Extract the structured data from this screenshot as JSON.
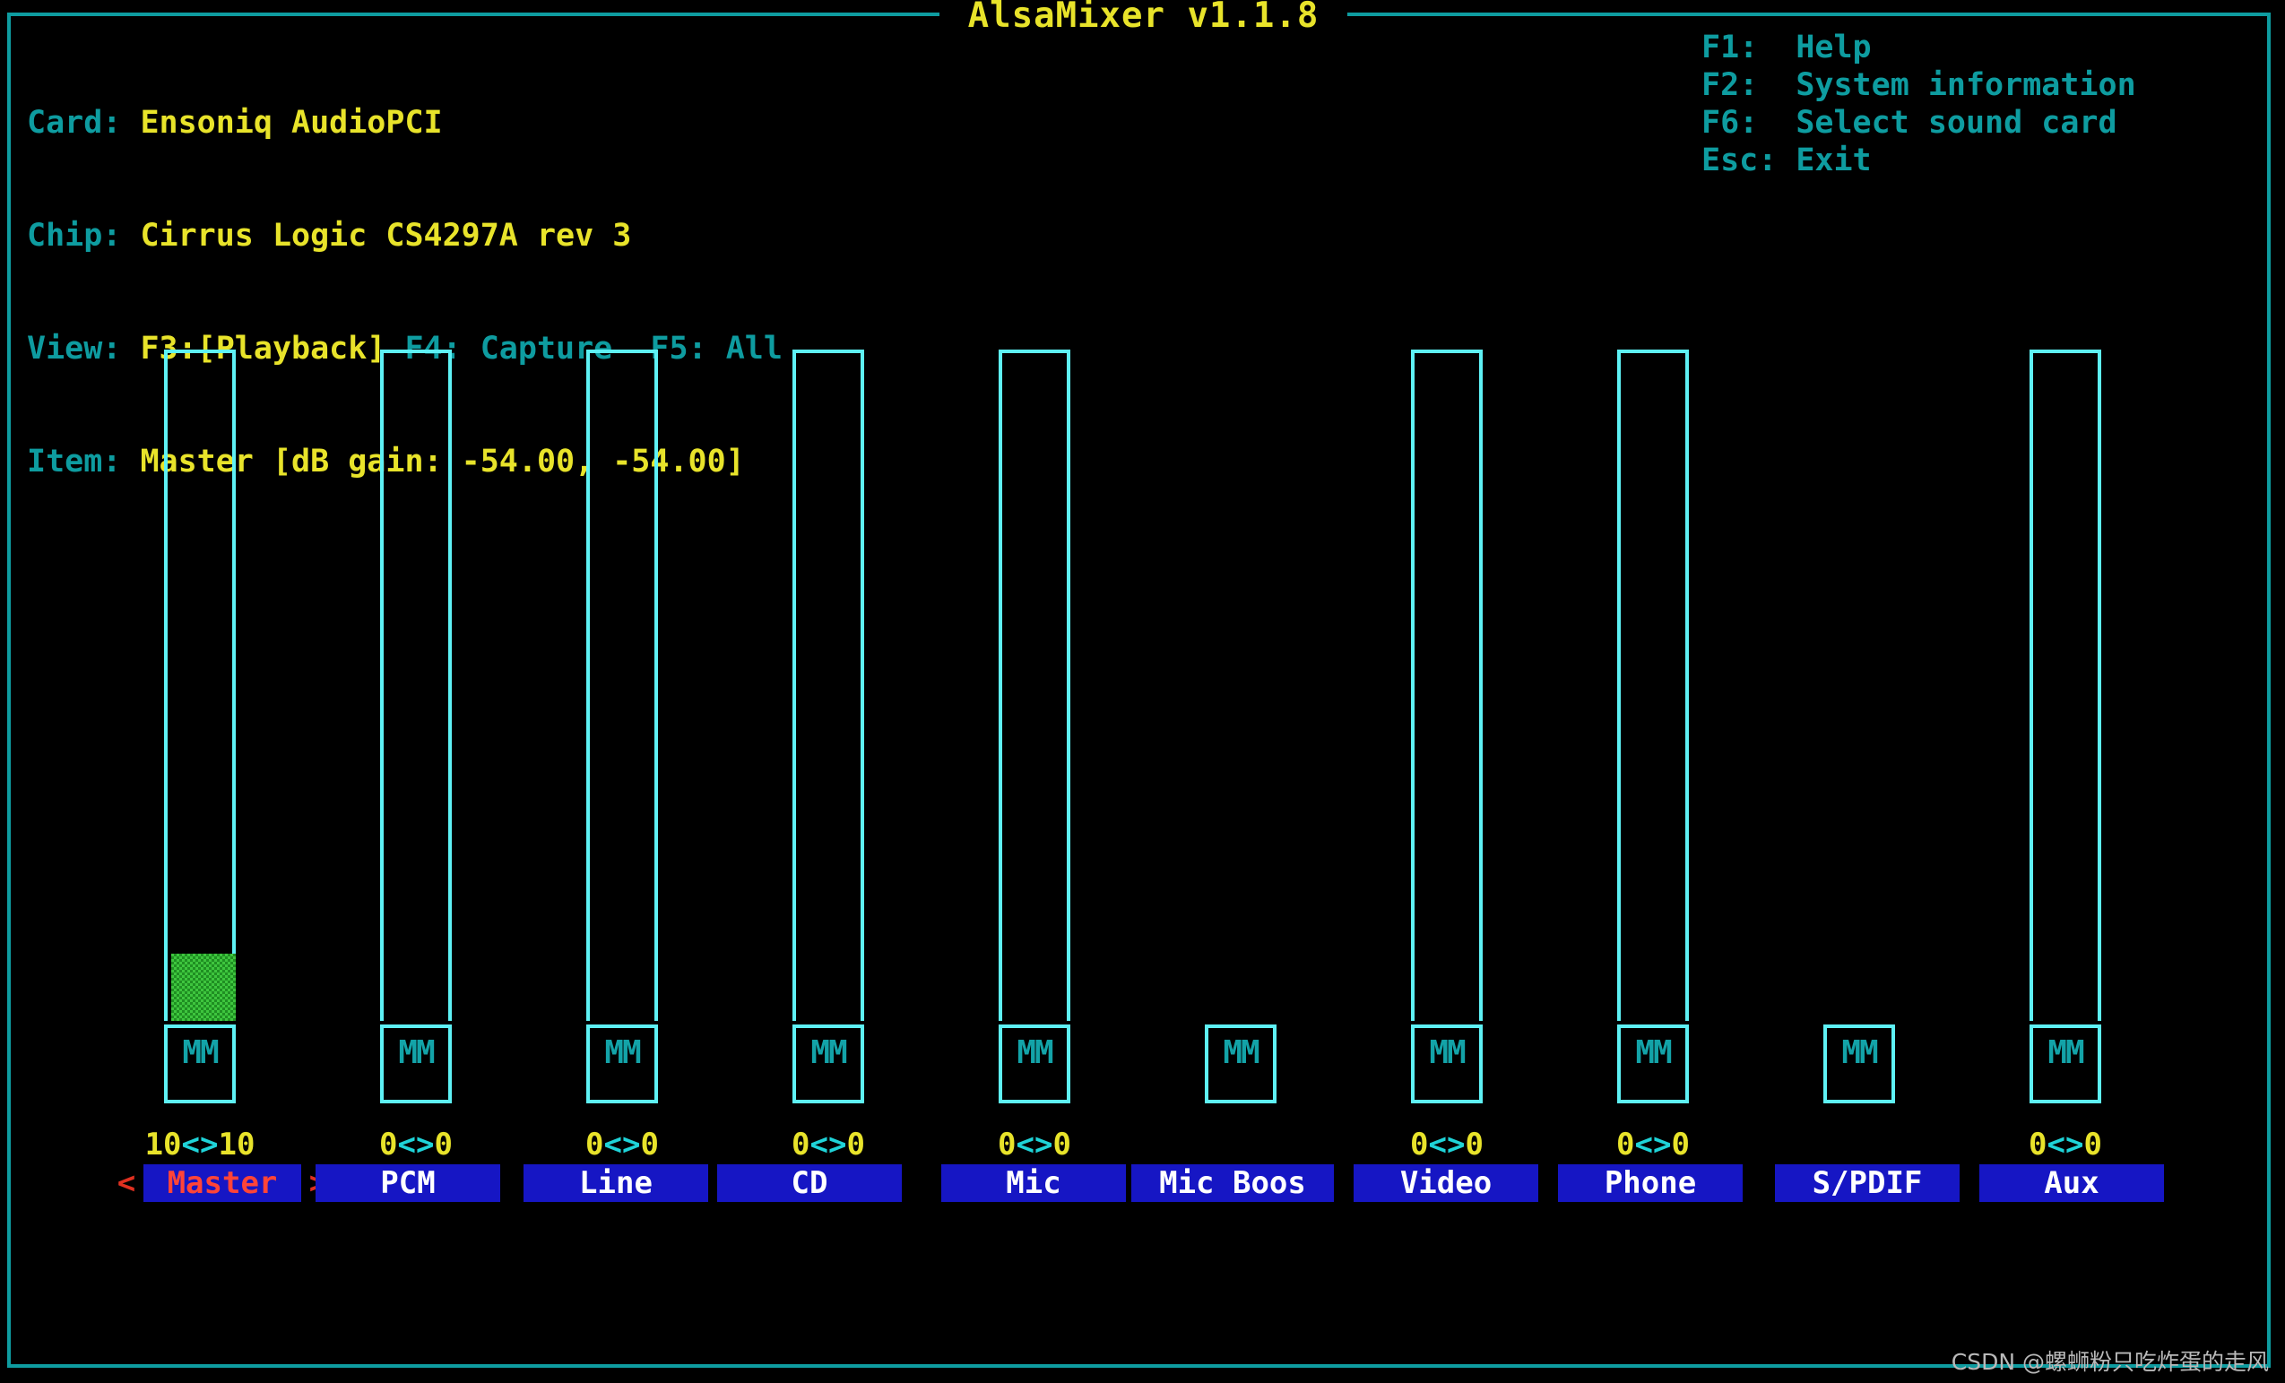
{
  "window": {
    "title": "AlsaMixer v1.1.8"
  },
  "info": {
    "card_label": "Card:",
    "card_value": "Ensoniq AudioPCI",
    "chip_label": "Chip:",
    "chip_value": "Cirrus Logic CS4297A rev 3",
    "view_label": "View:",
    "view_playback": "F3:[Playback]",
    "view_capture": "F4: Capture",
    "view_all": "F5: All",
    "item_label": "Item:",
    "item_value": "Master [dB gain: -54.00, -54.00]"
  },
  "help": [
    {
      "key": "F1:",
      "action": "Help"
    },
    {
      "key": "F2:",
      "action": "System information"
    },
    {
      "key": "F6:",
      "action": "Select sound card"
    },
    {
      "key": "Esc:",
      "action": "Exit"
    }
  ],
  "colors": {
    "background": "#000000",
    "frame": "#0e9ca0",
    "title": "#e8e32a",
    "label": "#0e9ca0",
    "value": "#e8e32a",
    "bar_border": "#5ef1f5",
    "bar_fill": "#3ec53e",
    "mute_text": "#13a3a8",
    "name_bg": "#1616c4",
    "name_fg": "#ffffff",
    "selected_fg": "#ff4438",
    "arrow": "#e03020",
    "number": "#e8e32a",
    "number_separator": "#1fd3d8"
  },
  "channels": [
    {
      "name": "Master",
      "selected": true,
      "has_volume_bar": true,
      "volume_left": "10",
      "volume_right": "10",
      "separator": "<>",
      "level_percent": 10,
      "mute_indicator": "MM",
      "left_arrow": "<",
      "right_arrow": ">"
    },
    {
      "name": "PCM",
      "selected": false,
      "has_volume_bar": true,
      "volume_left": "0",
      "volume_right": "0",
      "separator": "<>",
      "level_percent": 0,
      "mute_indicator": "MM"
    },
    {
      "name": "Line",
      "selected": false,
      "has_volume_bar": true,
      "volume_left": "0",
      "volume_right": "0",
      "separator": "<>",
      "level_percent": 0,
      "mute_indicator": "MM"
    },
    {
      "name": "CD",
      "selected": false,
      "has_volume_bar": true,
      "volume_left": "0",
      "volume_right": "0",
      "separator": "<>",
      "level_percent": 0,
      "mute_indicator": "MM"
    },
    {
      "name": "Mic",
      "selected": false,
      "has_volume_bar": true,
      "volume_left": "0",
      "volume_right": "0",
      "separator": "<>",
      "level_percent": 0,
      "mute_indicator": "MM"
    },
    {
      "name": "Mic Boos",
      "selected": false,
      "has_volume_bar": false,
      "volume_left": "",
      "volume_right": "",
      "separator": "",
      "level_percent": 0,
      "mute_indicator": "MM"
    },
    {
      "name": "Video",
      "selected": false,
      "has_volume_bar": true,
      "volume_left": "0",
      "volume_right": "0",
      "separator": "<>",
      "level_percent": 0,
      "mute_indicator": "MM"
    },
    {
      "name": "Phone",
      "selected": false,
      "has_volume_bar": true,
      "volume_left": "0",
      "volume_right": "0",
      "separator": "<>",
      "level_percent": 0,
      "mute_indicator": "MM"
    },
    {
      "name": "S/PDIF",
      "selected": false,
      "has_volume_bar": false,
      "volume_left": "",
      "volume_right": "",
      "separator": "",
      "level_percent": 0,
      "mute_indicator": "MM"
    },
    {
      "name": "Aux",
      "selected": false,
      "has_volume_bar": true,
      "volume_left": "0",
      "volume_right": "0",
      "separator": "<>",
      "level_percent": 0,
      "mute_indicator": "MM"
    }
  ],
  "watermark": "CSDN @螺蛳粉只吃炸蛋的走风"
}
